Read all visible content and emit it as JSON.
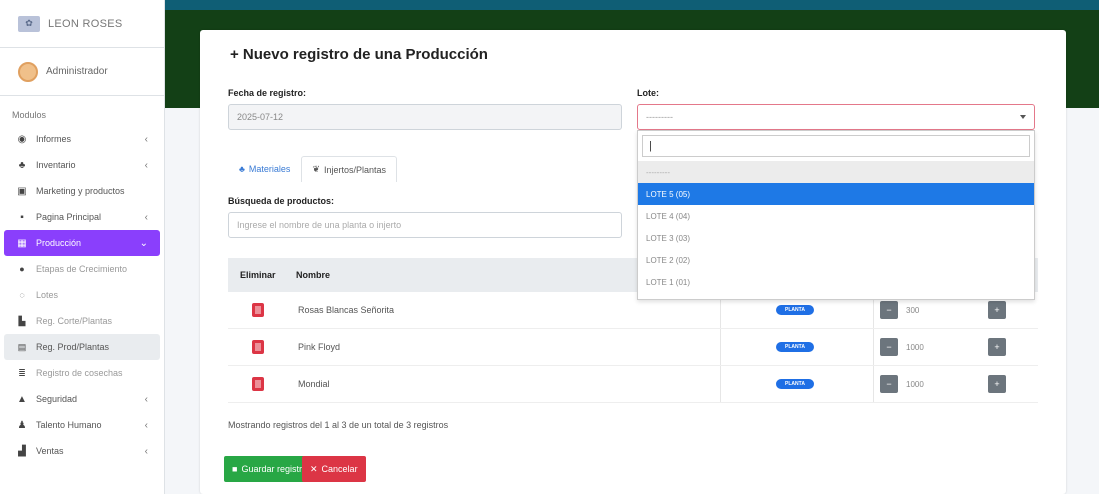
{
  "brand": {
    "name": "LEON ROSES"
  },
  "user": {
    "name": "Administrador"
  },
  "sidebar": {
    "section": "Modulos",
    "items": [
      {
        "label": "Informes",
        "icon": "globe-icon"
      },
      {
        "label": "Inventario",
        "icon": "users-icon"
      },
      {
        "label": "Marketing y productos",
        "icon": "megaphone-icon"
      },
      {
        "label": "Pagina Principal",
        "icon": "home-icon"
      },
      {
        "label": "Producción",
        "icon": "calendar-icon"
      },
      {
        "label": "Etapas de Crecimiento",
        "icon": "circle-icon"
      },
      {
        "label": "Lotes",
        "icon": "ring-icon"
      },
      {
        "label": "Reg. Corte/Plantas",
        "icon": "table-icon"
      },
      {
        "label": "Reg. Prod/Plantas",
        "icon": "table-icon"
      },
      {
        "label": "Registro de cosechas",
        "icon": "list-icon"
      },
      {
        "label": "Seguridad",
        "icon": "lock-icon"
      },
      {
        "label": "Talento Humano",
        "icon": "people-icon"
      },
      {
        "label": "Ventas",
        "icon": "chart-icon"
      }
    ]
  },
  "form": {
    "title": "+ Nuevo registro de una Producción",
    "fecha_label": "Fecha de registro:",
    "fecha_value": "2025-07-12",
    "lote_label": "Lote:",
    "lote_value": "---------",
    "tabs": [
      "Materiales",
      "Injertos/Plantas"
    ],
    "search_label": "Búsqueda de productos:",
    "search_placeholder": "Ingrese el nombre de una planta o injerto"
  },
  "dropdown": {
    "search_value": "|",
    "options": [
      "---------",
      "LOTE 5 (05)",
      "LOTE 4 (04)",
      "LOTE 3 (03)",
      "LOTE 2 (02)",
      "LOTE 1 (01)"
    ]
  },
  "table": {
    "headers": {
      "del": "Eliminar",
      "name": "Nombre"
    },
    "rows": [
      {
        "name": "Rosas Blancas Señorita",
        "badge": "PLANTA",
        "qty": "300"
      },
      {
        "name": "Pink Floyd",
        "badge": "PLANTA",
        "qty": "1000"
      },
      {
        "name": "Mondial",
        "badge": "PLANTA",
        "qty": "1000"
      }
    ],
    "info": "Mostrando registros del 1 al 3 de un total de 3 registros"
  },
  "buttons": {
    "save": "Guardar registro",
    "cancel": "Cancelar"
  },
  "colors": {
    "accent": "#8a3ffc",
    "header": "#134016",
    "primary": "#1e79e6",
    "success": "#28a745",
    "danger": "#dc3545"
  }
}
